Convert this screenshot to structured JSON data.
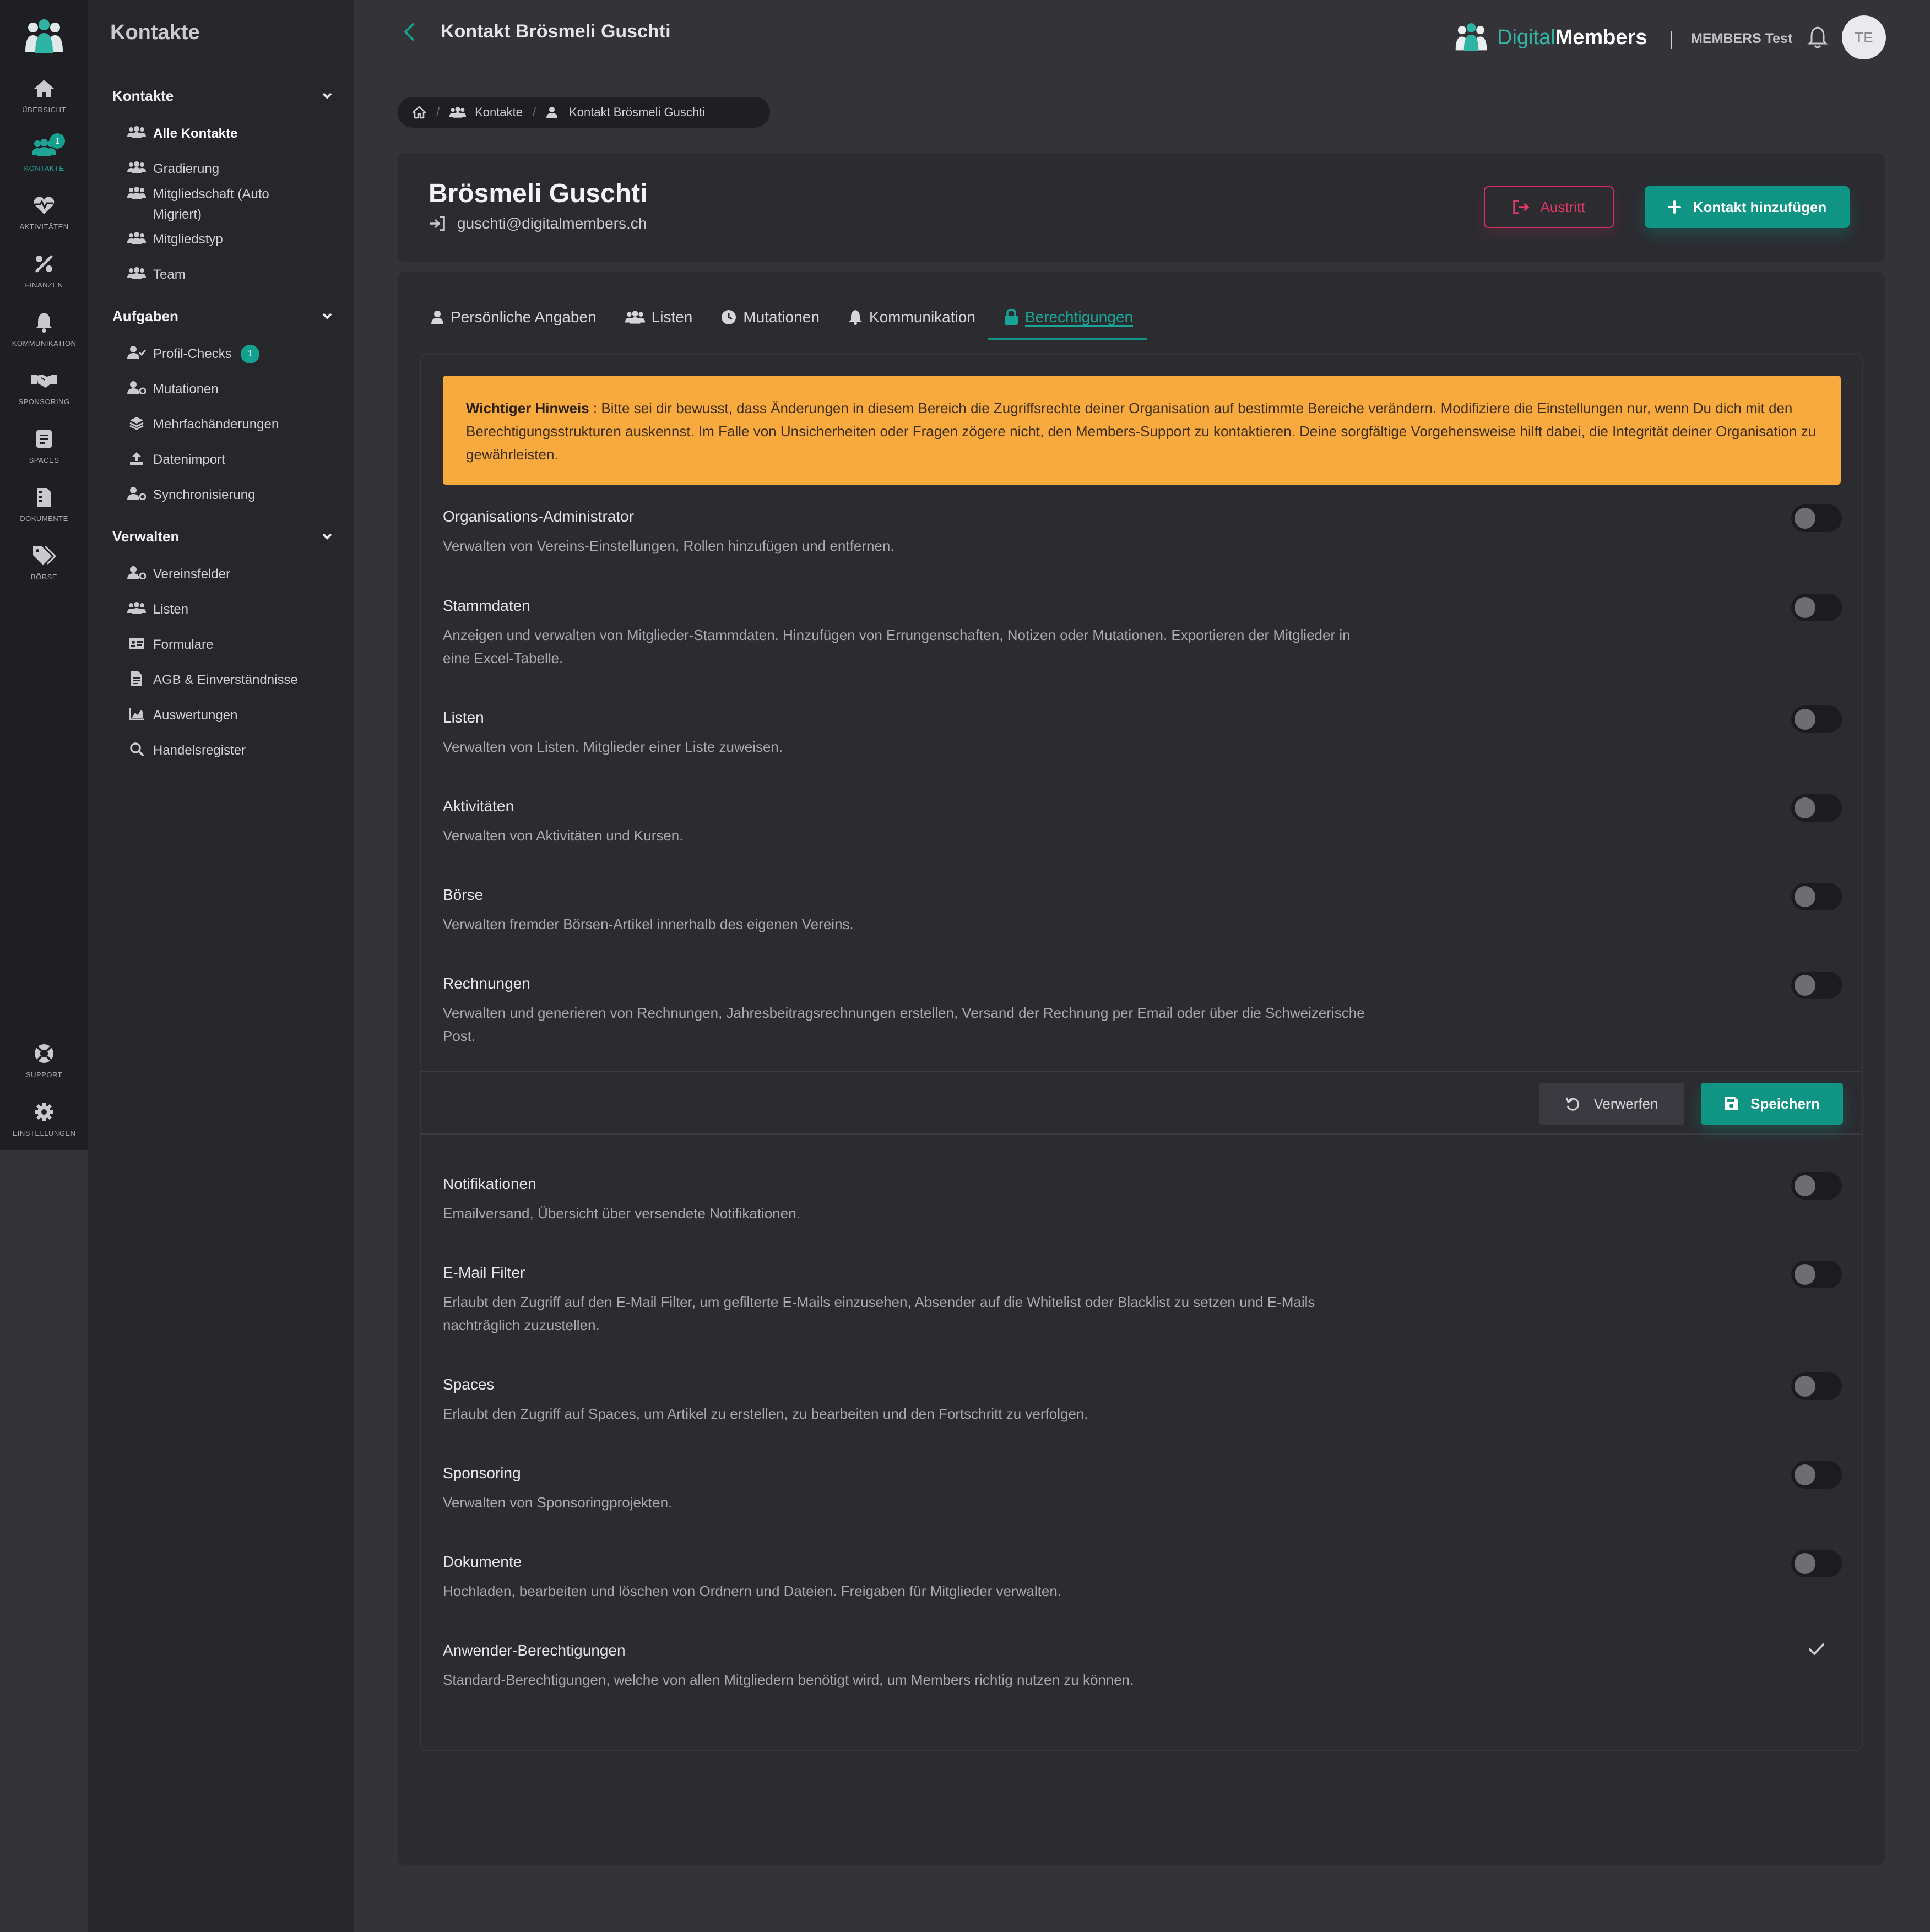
{
  "rail": {
    "items": [
      {
        "label": "ÜBERSICHT",
        "icon": "home-icon"
      },
      {
        "label": "KONTAKTE",
        "icon": "contacts-icon",
        "badge": "1"
      },
      {
        "label": "AKTIVITÄTEN",
        "icon": "heart-pulse-icon"
      },
      {
        "label": "FINANZEN",
        "icon": "percent-icon"
      },
      {
        "label": "KOMMUNIKATION",
        "icon": "bell-icon"
      },
      {
        "label": "SPONSORING",
        "icon": "handshake-icon"
      },
      {
        "label": "SPACES",
        "icon": "spaces-icon"
      },
      {
        "label": "DOKUMENTE",
        "icon": "document-icon"
      },
      {
        "label": "BÖRSE",
        "icon": "tag-icon"
      },
      {
        "label": "SUPPORT",
        "icon": "lifebuoy-icon"
      },
      {
        "label": "EINSTELLUNGEN",
        "icon": "gear-icon"
      }
    ]
  },
  "sidenav": {
    "title": "Kontakte",
    "sections": [
      {
        "title": "Kontakte",
        "items": [
          {
            "label": "Alle Kontakte",
            "icon": "users-icon"
          },
          {
            "label": "Gradierung",
            "icon": "users-icon"
          },
          {
            "label": "Mitgliedschaft (Auto Migriert)",
            "icon": "users-icon"
          },
          {
            "label": "Mitgliedstyp",
            "icon": "users-icon"
          },
          {
            "label": "Team",
            "icon": "users-icon"
          }
        ]
      },
      {
        "title": "Aufgaben",
        "items": [
          {
            "label": "Profil-Checks",
            "icon": "user-check-icon",
            "badge": "1"
          },
          {
            "label": "Mutationen",
            "icon": "user-cog-icon"
          },
          {
            "label": "Mehrfachänderungen",
            "icon": "layers-icon"
          },
          {
            "label": "Datenimport",
            "icon": "upload-icon"
          },
          {
            "label": "Synchronisierung",
            "icon": "user-cog-icon"
          }
        ]
      },
      {
        "title": "Verwalten",
        "items": [
          {
            "label": "Vereinsfelder",
            "icon": "user-cog-icon"
          },
          {
            "label": "Listen",
            "icon": "users-icon"
          },
          {
            "label": "Formulare",
            "icon": "id-card-icon"
          },
          {
            "label": "AGB & Einverständnisse",
            "icon": "file-icon"
          },
          {
            "label": "Auswertungen",
            "icon": "chart-icon"
          },
          {
            "label": "Handelsregister",
            "icon": "search-icon"
          }
        ]
      }
    ]
  },
  "header": {
    "title": "Kontakt Brösmeli Guschti",
    "brand_part1": "Digital",
    "brand_part2": "Members",
    "separator": "|",
    "org": "MEMBERS Test",
    "avatar_initials": "TE"
  },
  "breadcrumb": {
    "items": [
      "Kontakte",
      "Kontakt Brösmeli Guschti"
    ],
    "separator": "/"
  },
  "contact": {
    "name": "Brösmeli Guschti",
    "email": "guschti@digitalmembers.ch",
    "exit_label": "Austritt",
    "add_label": "Kontakt hinzufügen"
  },
  "tabs": [
    {
      "label": "Persönliche Angaben",
      "icon": "user-icon"
    },
    {
      "label": "Listen",
      "icon": "users-icon"
    },
    {
      "label": "Mutationen",
      "icon": "clock-icon"
    },
    {
      "label": "Kommunikation",
      "icon": "bell-icon"
    },
    {
      "label": "Berechtigungen",
      "icon": "lock-icon",
      "active": true
    }
  ],
  "warning": {
    "title": "Wichtiger Hinweis",
    "text": " : Bitte sei dir bewusst, dass Änderungen in diesem Bereich die Zugriffsrechte deiner Organisation auf bestimmte Bereiche verändern. Modifiziere die Einstellungen nur, wenn Du dich mit den Berechtigungsstrukturen auskennst. Im Falle von Unsicherheiten oder Fragen zögere nicht, den Members-Support zu kontaktieren. Deine sorgfältige Vorgehensweise hilft dabei, die Integrität deiner Organisation zu gewährleisten."
  },
  "permissions_admin": [
    {
      "title": "Organisations-Administrator",
      "desc": "Verwalten von Vereins-Einstellungen, Rollen hinzufügen und entfernen.",
      "enabled": false
    },
    {
      "title": "Stammdaten",
      "desc": "Anzeigen und verwalten von Mitglieder-Stammdaten. Hinzufügen von Errungenschaften, Notizen oder Mutationen. Exportieren der Mitglieder in eine Excel-Tabelle.",
      "enabled": false
    },
    {
      "title": "Listen",
      "desc": "Verwalten von Listen. Mitglieder einer Liste zuweisen.",
      "enabled": false
    },
    {
      "title": "Aktivitäten",
      "desc": "Verwalten von Aktivitäten und Kursen.",
      "enabled": false
    },
    {
      "title": "Börse",
      "desc": "Verwalten fremder Börsen-Artikel innerhalb des eigenen Vereins.",
      "enabled": false
    },
    {
      "title": "Rechnungen",
      "desc": "Verwalten und generieren von Rechnungen, Jahresbeitragsrechnungen erstellen, Versand der Rechnung per Email oder über die Schweizerische Post.",
      "enabled": false
    }
  ],
  "actions": {
    "discard_label": "Verwerfen",
    "save_label": "Speichern"
  },
  "permissions_more": [
    {
      "title": "Notifikationen",
      "desc": "Emailversand, Übersicht über versendete Notifikationen.",
      "enabled": false
    },
    {
      "title": "E-Mail Filter",
      "desc": "Erlaubt den Zugriff auf den E-Mail Filter, um gefilterte E-Mails einzusehen, Absender auf die Whitelist oder Blacklist zu setzen und E-Mails nachträglich zuzustellen.",
      "enabled": false
    },
    {
      "title": "Spaces",
      "desc": "Erlaubt den Zugriff auf Spaces, um Artikel zu erstellen, zu bearbeiten und den Fortschritt zu verfolgen.",
      "enabled": false
    },
    {
      "title": "Sponsoring",
      "desc": "Verwalten von Sponsoringprojekten.",
      "enabled": false
    },
    {
      "title": "Dokumente",
      "desc": "Hochladen, bearbeiten und löschen von Ordnern und Dateien. Freigaben für Mitglieder verwalten.",
      "enabled": false
    },
    {
      "title": "Anwender-Berechtigungen",
      "desc": "Standard-Berechtigungen, welche von allen Mitgliedern benötigt wird, um Members richtig nutzen zu können.",
      "checked": true
    }
  ],
  "colors": {
    "accent": "#109585",
    "danger": "#d7305f",
    "warning": "#f9aa3f",
    "background": "#333338"
  }
}
